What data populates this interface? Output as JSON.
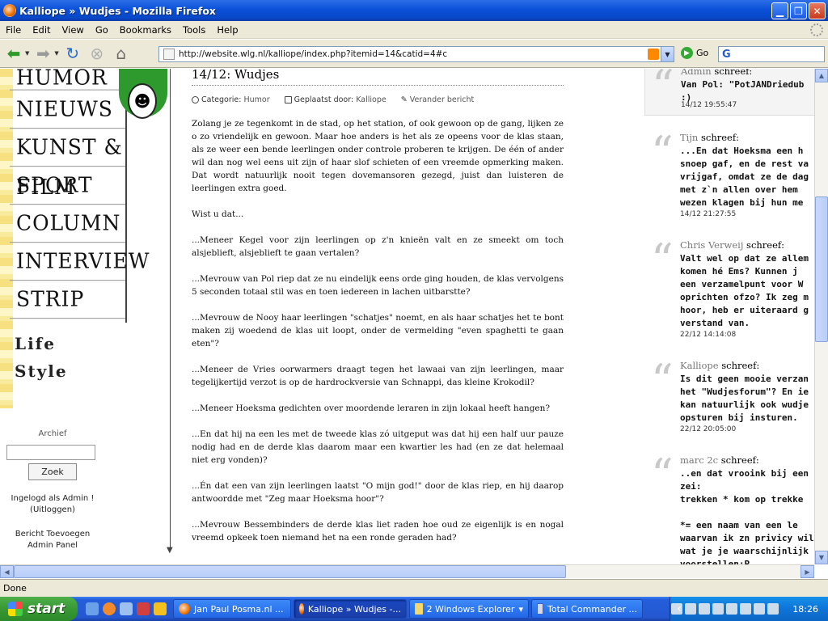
{
  "window": {
    "title": "Kalliope » Wudjes - Mozilla Firefox",
    "controls": [
      "minimize",
      "restore",
      "close"
    ]
  },
  "menu": [
    "File",
    "Edit",
    "View",
    "Go",
    "Bookmarks",
    "Tools",
    "Help"
  ],
  "toolbar": {
    "url": "http://website.wlg.nl/kalliope/index.php?itemid=14&catid=4#c",
    "go_label": "Go"
  },
  "sidebar": {
    "nav": [
      "HUMOR",
      "NIEUWS",
      "KUNST & FILM",
      "SPORT",
      "COLUMN",
      "INTERVIEW",
      "STRIP"
    ],
    "life_style": [
      "Life",
      "Style"
    ],
    "archive_label": "Archief",
    "search_button": "Zoek",
    "login_line1": "Ingelogd als Admin !",
    "login_line2": "(Uitloggen)",
    "link_add": "Bericht Toevoegen",
    "link_admin": "Admin Panel"
  },
  "article": {
    "title": "14/12: Wudjes",
    "category_label": "Categorie:",
    "category": "Humor",
    "posted_label": "Geplaatst door:",
    "author": "Kalliope",
    "edit": "Verander bericht",
    "paragraphs": [
      "Zolang je ze tegenkomt in de stad, op het station, of ook gewoon op de gang, lijken ze o zo vriendelijk en gewoon. Maar hoe anders is het als ze opeens voor de klas staan, als ze weer een bende leerlingen onder controle proberen te krijgen. De één of ander wil dan nog wel eens uit zijn of haar slof schieten of een vreemde opmerking maken. Dat wordt natuurlijk nooit tegen dovemansoren gezegd, juist dan luisteren de leerlingen extra goed.",
      "Wist u dat...",
      "...Meneer Kegel voor zijn leerlingen op z'n knieën valt en ze smeekt om toch alsjeblieft, alsjeblieft te gaan vertalen?",
      "...Mevrouw van Pol riep dat ze nu eindelijk eens orde ging houden, de klas vervolgens 5 seconden totaal stil was en toen iedereen in lachen uitbarstte?",
      "...Mevrouw de Nooy haar leerlingen \"schatjes\" noemt, en als haar schatjes het te bont maken zij woedend de klas uit loopt, onder de vermelding \"even spaghetti te gaan eten\"?",
      "...Meneer de Vries oorwarmers draagt tegen het lawaai van zijn leerlingen, maar tegelijkertijd verzot is op de hardrockversie van Schnappi, das kleine Krokodil?",
      "...Meneer Hoeksma gedichten over moordende leraren in zijn lokaal heeft hangen?",
      "...En dat hij na een les met de tweede klas zó uitgeput was dat hij een half uur pauze nodig had en de derde klas daarom maar een kwartier les had (en ze dat helemaal niet erg vonden)?",
      "...Én dat een van zijn leerlingen laatst \"O mijn god!\" door de klas riep, en hij daarop antwoordde met \"Zeg maar Hoeksma hoor\"?",
      "...Mevrouw Bessembinders de derde klas liet raden hoe oud ze eigenlijk is en nogal vreemd opkeek toen niemand het na een ronde geraden had?"
    ]
  },
  "comments": [
    {
      "name": "Admin",
      "says": "schreef:",
      "text": "Van Pol: \"PotJANDriedub\n:)",
      "time": "14/12 19:55:47"
    },
    {
      "name": "Tijn",
      "says": "schreef:",
      "text": "...En dat Hoeksma een h\nsnoep gaf, en de rest va\nvrijgaf, omdat ze de dag\nmet z`n allen over hem\nwezen klagen bij hun me",
      "time": "14/12 21:27:55"
    },
    {
      "name": "Chris Verweij",
      "says": "schreef:",
      "text": "Valt wel op dat ze allem\nkomen hé Ems? Kunnen j\neen verzamelpunt voor W\noprichten ofzo? Ik zeg m\nhoor, heb er uiteraard g\nverstand van.",
      "time": "22/12 14:14:08"
    },
    {
      "name": "Kalliope",
      "says": "schreef:",
      "text": "Is dit geen mooie verzan\nhet \"Wudjesforum\"? En ie\nkan natuurlijk ook wudje\nopsturen bij insturen.",
      "time": "22/12 20:05:00"
    },
    {
      "name": "marc 2c",
      "says": "schreef:",
      "text": "..en dat vrooink bij een\nzei:\ntrekken * kom op trekke\n\n*= een naam van een le\nwaarvan ik zn privicy wil\nwat je je waarschijnlijk v\nvoorstellen:P",
      "time": ""
    }
  ],
  "status": "Done",
  "taskbar": {
    "start": "start",
    "tasks": [
      {
        "label": "Jan Paul Posma.nl ...",
        "active": false
      },
      {
        "label": "Kalliope » Wudjes -...",
        "active": true
      },
      {
        "label": "2 Windows Explorer",
        "active": false
      },
      {
        "label": "Total Commander ...",
        "active": false
      }
    ],
    "clock": "18:26"
  }
}
